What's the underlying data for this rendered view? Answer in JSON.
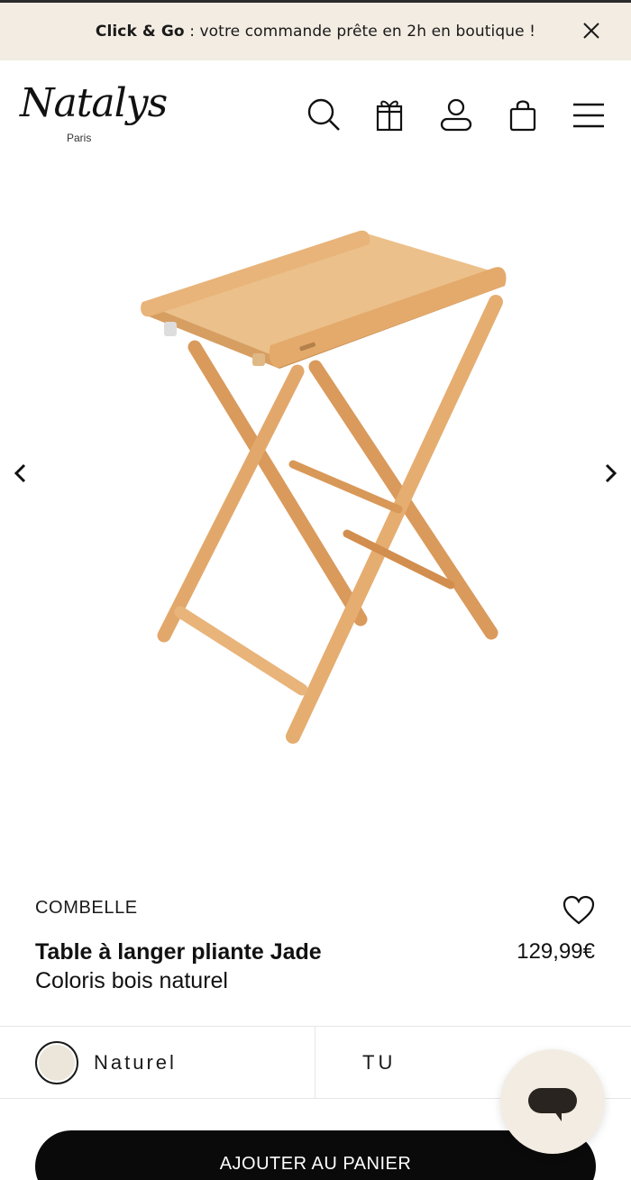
{
  "promo": {
    "highlight": "Click & Go",
    "message": " : votre commande prête en 2h en boutique !",
    "close_icon": "close-icon"
  },
  "header": {
    "logo_text": "Natalys",
    "logo_subtext": "Paris",
    "icons": [
      "search-icon",
      "gift-icon",
      "account-icon",
      "bag-icon",
      "menu-icon"
    ]
  },
  "gallery": {
    "prev_icon": "chevron-left-icon",
    "next_icon": "chevron-right-icon",
    "image_subject": "folding-changing-table-image"
  },
  "product": {
    "brand": "COMBELLE",
    "title": "Table à langer pliante Jade",
    "subtitle": "Coloris bois naturel",
    "price": "129,99€",
    "wishlist_icon": "heart-icon"
  },
  "options": {
    "color_label": "Naturel",
    "color_swatch": "#ebe6d9",
    "size_label": "TU"
  },
  "cart": {
    "button_label": "AJOUTER AU PANIER"
  },
  "chat": {
    "icon": "chat-bubble-icon"
  },
  "colors": {
    "promo_bg": "#f3ece2",
    "button_bg": "#0a0a0a",
    "wood": "#e8b47a"
  }
}
